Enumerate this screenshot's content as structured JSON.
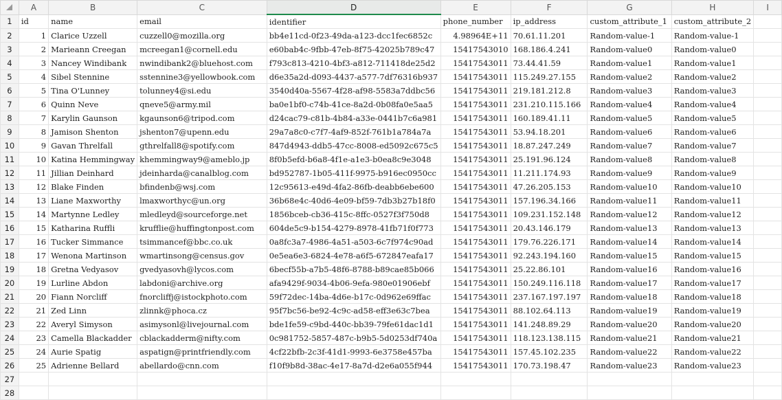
{
  "columns": [
    "",
    "A",
    "B",
    "C",
    "D",
    "E",
    "F",
    "G",
    "H",
    "I"
  ],
  "rows": [
    [
      "1",
      "id",
      "name",
      "email",
      "identifier",
      "phone_number",
      "ip_address",
      "custom_attribute_1",
      "custom_attribute_2",
      ""
    ],
    [
      "2",
      "1",
      "Clarice Uzzell",
      "cuzzell0@mozilla.org",
      "bb4e11cd-0f23-49da-a123-dcc1fec6852c",
      "4.98964E+11",
      "70.61.11.201",
      "Random-value-1",
      "Random-value-1",
      ""
    ],
    [
      "3",
      "2",
      "Marieann Creegan",
      "mcreegan1@cornell.edu",
      "e60bab4c-9fbb-47eb-8f75-42025b789c47",
      "15417543010",
      "168.186.4.241",
      "Random-value0",
      "Random-value0",
      ""
    ],
    [
      "4",
      "3",
      "Nancey Windibank",
      "nwindibank2@bluehost.com",
      "f793c813-4210-4bf3-a812-711418de25d2",
      "15417543011",
      "73.44.41.59",
      "Random-value1",
      "Random-value1",
      ""
    ],
    [
      "5",
      "4",
      "Sibel Stennine",
      "sstennine3@yellowbook.com",
      "d6e35a2d-d093-4437-a577-7df76316b937",
      "15417543011",
      "115.249.27.155",
      "Random-value2",
      "Random-value2",
      ""
    ],
    [
      "6",
      "5",
      "Tina O'Lunney",
      "tolunney4@si.edu",
      "3540d40a-5567-4f28-af98-5583a7ddbc56",
      "15417543011",
      "219.181.212.8",
      "Random-value3",
      "Random-value3",
      ""
    ],
    [
      "7",
      "6",
      "Quinn Neve",
      "qneve5@army.mil",
      "ba0e1bf0-c74b-41ce-8a2d-0b08fa0e5aa5",
      "15417543011",
      "231.210.115.166",
      "Random-value4",
      "Random-value4",
      ""
    ],
    [
      "8",
      "7",
      "Karylin Gaunson",
      "kgaunson6@tripod.com",
      "d24cac79-c81b-4b84-a33e-0441b7c6a981",
      "15417543011",
      "160.189.41.11",
      "Random-value5",
      "Random-value5",
      ""
    ],
    [
      "9",
      "8",
      "Jamison Shenton",
      "jshenton7@upenn.edu",
      "29a7a8c0-c7f7-4af9-852f-761b1a784a7a",
      "15417543011",
      "53.94.18.201",
      "Random-value6",
      "Random-value6",
      ""
    ],
    [
      "10",
      "9",
      "Gavan Threlfall",
      "gthrelfall8@spotify.com",
      "847d4943-ddb5-47cc-8008-ed5092c675c5",
      "15417543011",
      "18.87.247.249",
      "Random-value7",
      "Random-value7",
      ""
    ],
    [
      "11",
      "10",
      "Katina Hemmingway",
      "khemmingway9@ameblo.jp",
      "8f0b5efd-b6a8-4f1e-a1e3-b0ea8c9e3048",
      "15417543011",
      "25.191.96.124",
      "Random-value8",
      "Random-value8",
      ""
    ],
    [
      "12",
      "11",
      "Jillian Deinhard",
      "jdeinharda@canalblog.com",
      "bd952787-1b05-411f-9975-b916ec0950cc",
      "15417543011",
      "11.211.174.93",
      "Random-value9",
      "Random-value9",
      ""
    ],
    [
      "13",
      "12",
      "Blake Finden",
      "bfindenb@wsj.com",
      "12c95613-e49d-4fa2-86fb-deabb6ebe600",
      "15417543011",
      "47.26.205.153",
      "Random-value10",
      "Random-value10",
      ""
    ],
    [
      "14",
      "13",
      "Liane Maxworthy",
      "lmaxworthyc@un.org",
      "36b68e4c-40d6-4e09-bf59-7db3b27b18f0",
      "15417543011",
      "157.196.34.166",
      "Random-value11",
      "Random-value11",
      ""
    ],
    [
      "15",
      "14",
      "Martynne Ledley",
      "mledleyd@sourceforge.net",
      "1856bceb-cb36-415c-8ffc-0527f3f750d8",
      "15417543011",
      "109.231.152.148",
      "Random-value12",
      "Random-value12",
      ""
    ],
    [
      "16",
      "15",
      "Katharina Ruffli",
      "krufflie@huffingtonpost.com",
      "604de5c9-b154-4279-8978-41fb71f0f773",
      "15417543011",
      "20.43.146.179",
      "Random-value13",
      "Random-value13",
      ""
    ],
    [
      "17",
      "16",
      "Tucker Simmance",
      "tsimmancef@bbc.co.uk",
      "0a8fc3a7-4986-4a51-a503-6c7f974c90ad",
      "15417543011",
      "179.76.226.171",
      "Random-value14",
      "Random-value14",
      ""
    ],
    [
      "18",
      "17",
      "Wenona Martinson",
      "wmartinsong@census.gov",
      "0e5ea6e3-6824-4e78-a6f5-672847eafa17",
      "15417543011",
      "92.243.194.160",
      "Random-value15",
      "Random-value15",
      ""
    ],
    [
      "19",
      "18",
      "Gretna Vedyasov",
      "gvedyasovh@lycos.com",
      "6becf55b-a7b5-48f6-8788-b89cae85b066",
      "15417543011",
      "25.22.86.101",
      "Random-value16",
      "Random-value16",
      ""
    ],
    [
      "20",
      "19",
      "Lurline Abdon",
      "labdoni@archive.org",
      "afa9429f-9034-4b06-9efa-980e01906ebf",
      "15417543011",
      "150.249.116.118",
      "Random-value17",
      "Random-value17",
      ""
    ],
    [
      "21",
      "20",
      "Fiann Norcliff",
      "fnorcliffj@istockphoto.com",
      "59f72dec-14ba-4d6e-b17c-0d962e69ffac",
      "15417543011",
      "237.167.197.197",
      "Random-value18",
      "Random-value18",
      ""
    ],
    [
      "22",
      "21",
      "Zed Linn",
      "zlinnk@phoca.cz",
      "95f7bc56-be92-4c9c-ad58-eff3e63c7bea",
      "15417543011",
      "88.102.64.113",
      "Random-value19",
      "Random-value19",
      ""
    ],
    [
      "23",
      "22",
      "Averyl Simyson",
      "asimysonl@livejournal.com",
      "bde1fe59-c9bd-440c-bb39-79fe61dac1d1",
      "15417543011",
      "141.248.89.29",
      "Random-value20",
      "Random-value20",
      ""
    ],
    [
      "24",
      "23",
      "Camella Blackadder",
      "cblackadderm@nifty.com",
      "0c981752-5857-487c-b9b5-5d0253df740a",
      "15417543011",
      "118.123.138.115",
      "Random-value21",
      "Random-value21",
      ""
    ],
    [
      "25",
      "24",
      "Aurie Spatig",
      "aspatign@printfriendly.com",
      "4cf22bfb-2c3f-41d1-9993-6e3758e457ba",
      "15417543011",
      "157.45.102.235",
      "Random-value22",
      "Random-value22",
      ""
    ],
    [
      "26",
      "25",
      "Adrienne Bellard",
      "abellardo@cnn.com",
      "f10f9b8d-38ac-4e17-8a7d-d2e6a055f944",
      "15417543011",
      "170.73.198.47",
      "Random-value23",
      "Random-value23",
      ""
    ],
    [
      "27",
      "",
      "",
      "",
      "",
      "",
      "",
      "",
      "",
      ""
    ],
    [
      "28",
      "",
      "",
      "",
      "",
      "",
      "",
      "",
      "",
      ""
    ]
  ]
}
